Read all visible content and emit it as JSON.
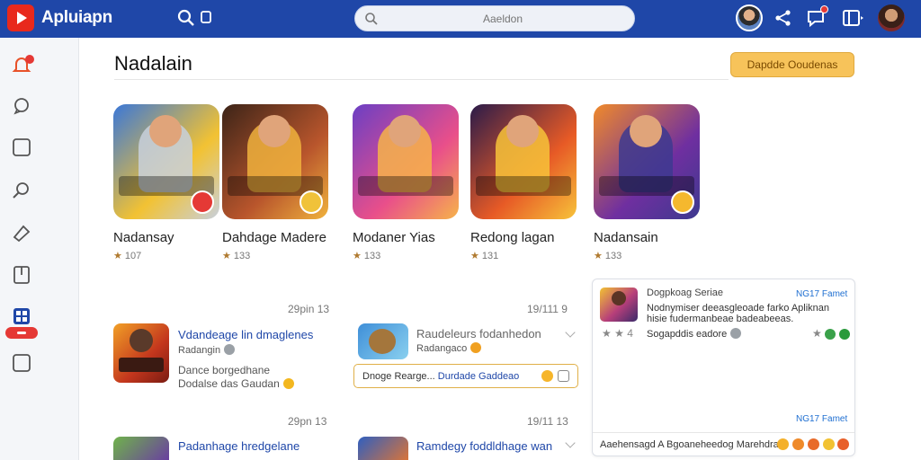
{
  "app": {
    "title": "Apluiapn"
  },
  "search": {
    "placeholder": "Aaeldon"
  },
  "page": {
    "title": "Nadalain",
    "cta_label": "Dapdde Ooudenas"
  },
  "games": [
    {
      "name": "Nadansay",
      "rating": "107",
      "colors": [
        "#3a77d8",
        "#f2c233",
        "#c8d0dc"
      ],
      "badge": "#e53935"
    },
    {
      "name": "Dahdage Madere",
      "rating": "133",
      "colors": [
        "#3c2418",
        "#b8552c",
        "#f0b23d"
      ],
      "badge": "#f0c23a"
    },
    {
      "name": "Modaner Yias",
      "rating": "133",
      "colors": [
        "#6b3fc4",
        "#e94f8a",
        "#f6b34a"
      ],
      "badge": ""
    },
    {
      "name": "Redong lagan",
      "rating": "131",
      "colors": [
        "#2a1b4a",
        "#e75a26",
        "#f7c33a"
      ],
      "badge": ""
    },
    {
      "name": "Nadansain",
      "rating": "133",
      "colors": [
        "#f08a2a",
        "#6f2fa0",
        "#3d3a8f"
      ],
      "badge": "#f5b82e"
    }
  ],
  "feed": [
    {
      "date": "29pin 13",
      "title": "Vdandeage lin dmaglenes",
      "sub1": "Radangin",
      "sub2": "Dance borgedhane",
      "sub3": "Dodalse das Gaudan"
    },
    {
      "date": "19/111 9",
      "title": "Raudeleurs fodanhedon",
      "sub1": "Radangaco",
      "reply_text": "Dnoge Rearge...",
      "reply_link": "Durdade Gaddeao"
    },
    {
      "date": "29pn 13",
      "title": "Padanhage hredgelane"
    },
    {
      "date": "19/11 13",
      "title": "Ramdegy foddldhage wan"
    }
  ],
  "panel": {
    "title": "Dogpkoag Seriae",
    "link_top": "NG17 Famet",
    "text": "Nodnymiser deeasgleoade farko Apliknan hisie fudermanbeae badeabeeas.",
    "stars": "4",
    "status": "Sogapddis eadore",
    "link_bottom": "NG17 Famet",
    "footer": "Aaehensagd A Bgoaneheedog Marehdra"
  },
  "accent": "#1f47a8",
  "brand_red": "#e8291c"
}
